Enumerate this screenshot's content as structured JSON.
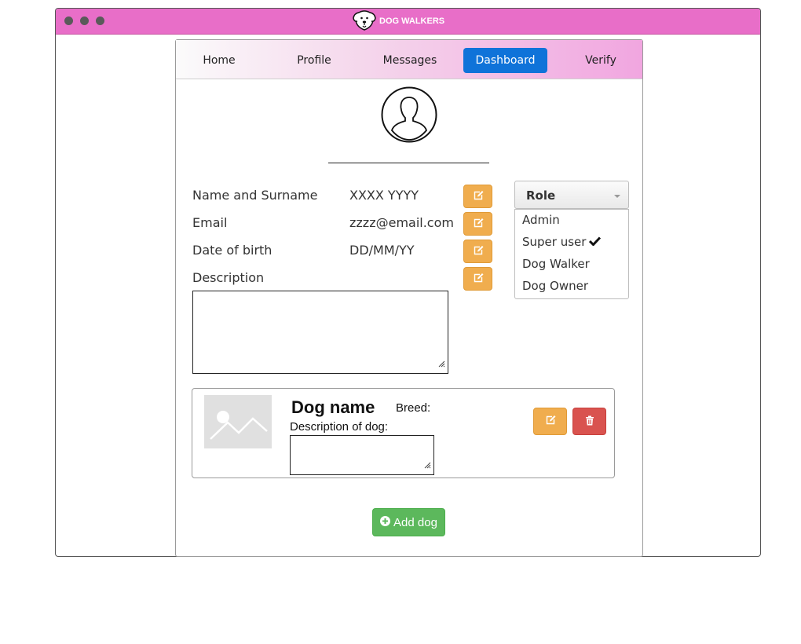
{
  "app": {
    "title": "DOG WALKERS",
    "logo_icon": "dog-face-icon"
  },
  "window": {
    "controls": [
      "dot",
      "dot",
      "dot"
    ]
  },
  "nav": {
    "tabs": [
      {
        "label": "Home",
        "active": false
      },
      {
        "label": "Profile",
        "active": false
      },
      {
        "label": "Messages",
        "active": false
      },
      {
        "label": "Dashboard",
        "active": true
      },
      {
        "label": "Verify",
        "active": false
      }
    ],
    "active_color": "#0f73d9"
  },
  "profile": {
    "avatar_icon": "user-avatar-icon",
    "fields": [
      {
        "label": "Name and Surname",
        "value": "XXXX YYYY"
      },
      {
        "label": "Email",
        "value": "zzzz@email.com"
      },
      {
        "label": "Date of birth",
        "value": "DD/MM/YY"
      },
      {
        "label": "Description",
        "value": ""
      }
    ],
    "edit_icon": "edit-icon"
  },
  "role": {
    "label": "Role",
    "options": [
      {
        "label": "Admin",
        "checked": false
      },
      {
        "label": "Super user",
        "checked": true
      },
      {
        "label": "Dog Walker",
        "checked": false
      },
      {
        "label": "Dog Owner",
        "checked": false
      }
    ]
  },
  "dog_card": {
    "image_icon": "image-placeholder-icon",
    "name": "Dog name",
    "breed_label": "Breed:",
    "description_label": "Description of dog:",
    "edit_icon": "edit-icon",
    "delete_icon": "trash-icon"
  },
  "add_dog": {
    "label": "Add dog",
    "icon": "plus-circle-icon"
  },
  "colors": {
    "titlebar": "#e86ec8",
    "edit_button": "#f0ad4e",
    "delete_button": "#d9534f",
    "add_button": "#5cb85c"
  }
}
